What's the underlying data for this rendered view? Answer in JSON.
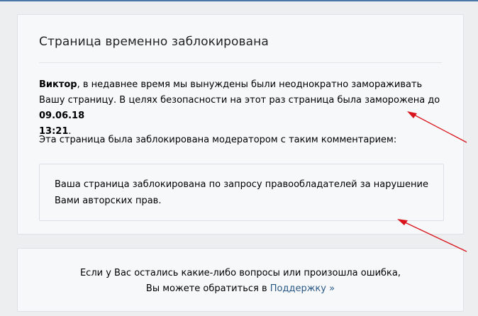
{
  "block_card": {
    "title": "Страница временно заблокирована",
    "message": {
      "user_name": "Виктор",
      "text_before_date": ", в недавнее время мы вынуждены были неоднократно замораживать Вашу страницу. В целях безопасности на этот раз страница была заморожена до ",
      "date": "09.06.18",
      "time": "13:21",
      "text_after": "."
    },
    "moderator_note": "Эта страница была заблокирована модератором с таким комментарием:",
    "comment": "Ваша страница заблокирована по запросу правообладателей за нарушение Вами авторских прав."
  },
  "support_card": {
    "line1": "Если у Вас остались какие-либо вопросы или произошла ошибка,",
    "line2_prefix": "Вы можете обратиться в ",
    "link_text": "Поддержку »"
  },
  "colors": {
    "background": "#edeef0",
    "card": "#f7f8fa",
    "link": "#2a5885",
    "annotation_arrow": "#d9141c"
  }
}
